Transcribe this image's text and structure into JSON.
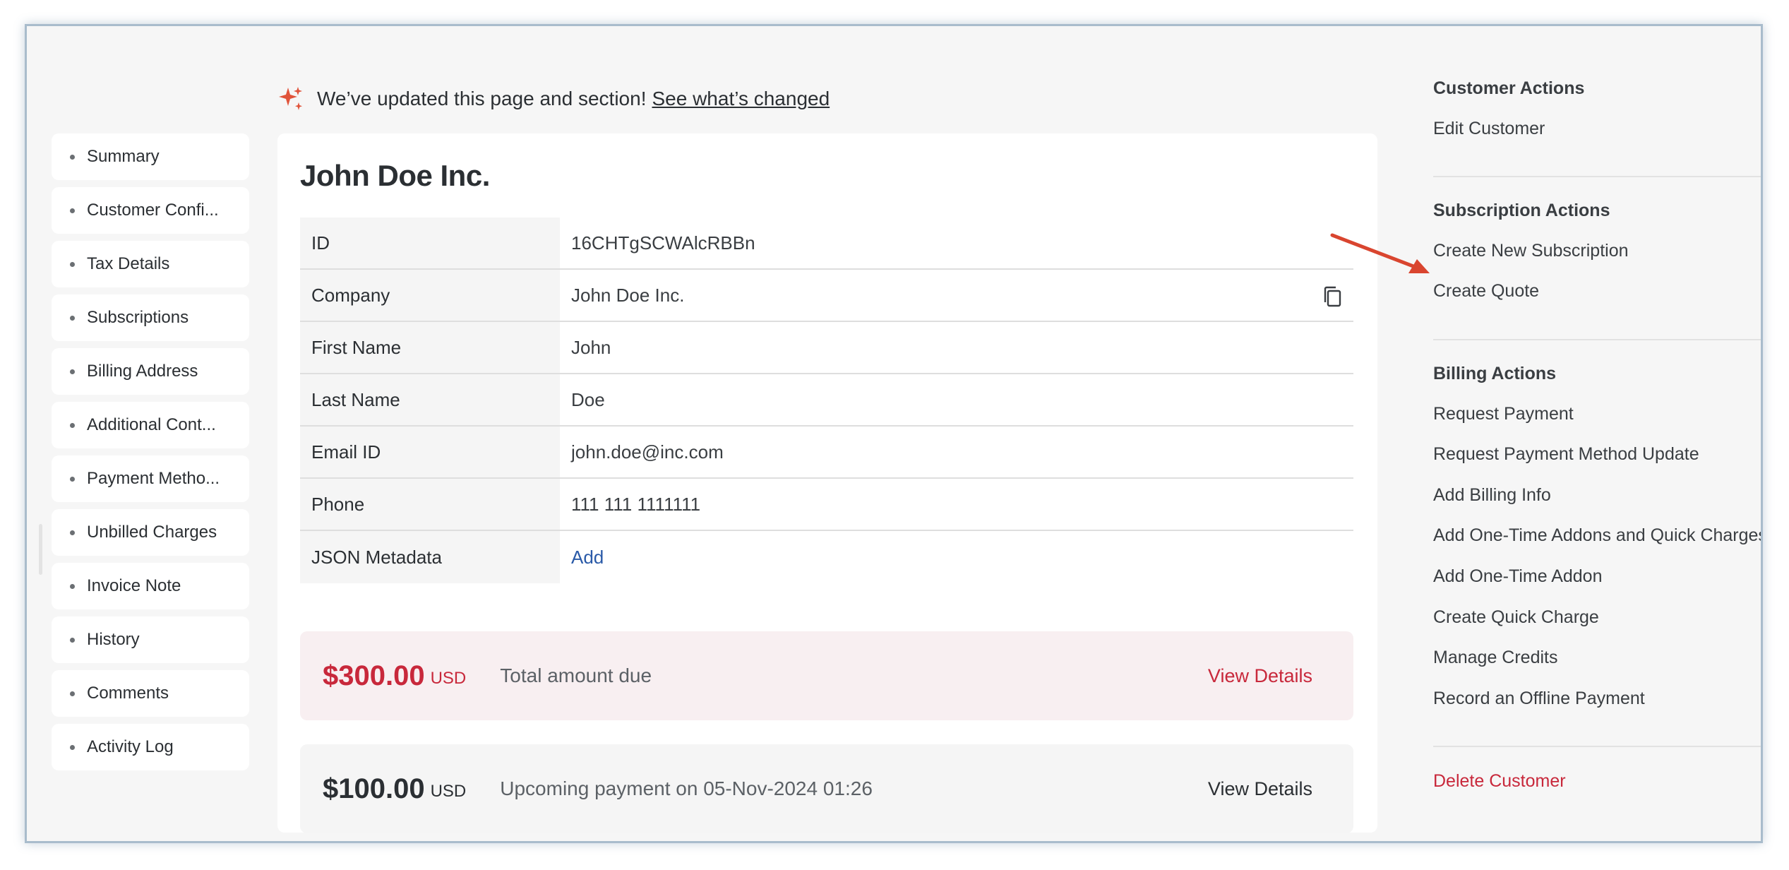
{
  "banner": {
    "text": "We’ve updated this page and section!",
    "link": "See what’s changed"
  },
  "nav": [
    "Summary",
    "Customer Confi...",
    "Tax Details",
    "Subscriptions",
    "Billing Address",
    "Additional Cont...",
    "Payment Metho...",
    "Unbilled Charges",
    "Invoice Note",
    "History",
    "Comments",
    "Activity Log"
  ],
  "customer": {
    "name": "John Doe Inc.",
    "fields": [
      {
        "label": "ID",
        "value": "16CHTgSCWAlcRBBn"
      },
      {
        "label": "Company",
        "value": "John Doe Inc."
      },
      {
        "label": "First Name",
        "value": "John"
      },
      {
        "label": "Last Name",
        "value": "Doe"
      },
      {
        "label": "Email ID",
        "value": "john.doe@inc.com"
      },
      {
        "label": "Phone",
        "value": "111 111 1111111"
      },
      {
        "label": "JSON Metadata",
        "value": "Add"
      }
    ]
  },
  "due": {
    "amount": "$300.00",
    "currency": "USD",
    "desc": "Total amount due",
    "action": "View Details"
  },
  "upcoming": {
    "amount": "$100.00",
    "currency": "USD",
    "desc": "Upcoming payment on 05-Nov-2024 01:26",
    "action": "View Details"
  },
  "actions": {
    "customer_title": "Customer Actions",
    "customer": [
      "Edit Customer"
    ],
    "subscription_title": "Subscription Actions",
    "subscription": [
      "Create New Subscription",
      "Create Quote"
    ],
    "billing_title": "Billing Actions",
    "billing": [
      "Request Payment",
      "Request Payment Method Update",
      "Add Billing Info",
      "Add One-Time Addons and Quick Charges",
      "Add One-Time Addon",
      "Create Quick Charge",
      "Manage Credits",
      "Record an Offline Payment"
    ],
    "delete": "Delete Customer"
  },
  "colors": {
    "accent_red": "#c8283b",
    "link_blue": "#2a5aa8",
    "sparkle": "#e0533a",
    "annotation_arrow": "#d9452f"
  }
}
